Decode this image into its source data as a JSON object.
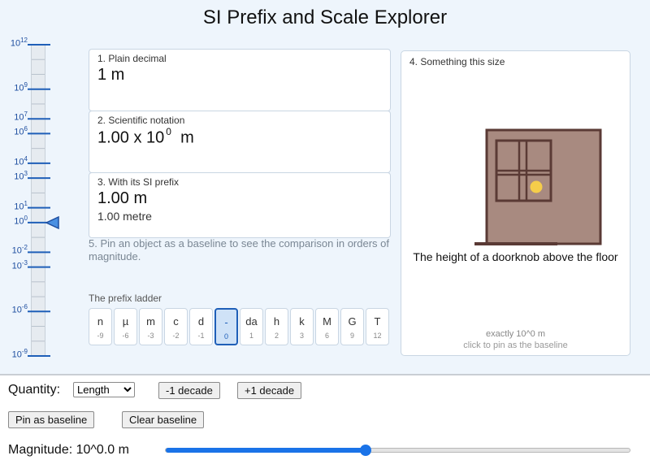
{
  "title": "SI Prefix and Scale Explorer",
  "ruler": {
    "labels": [
      {
        "base": "10",
        "exp": "12"
      },
      {
        "base": "10",
        "exp": "9"
      },
      {
        "base": "10",
        "exp": "7"
      },
      {
        "base": "10",
        "exp": "6"
      },
      {
        "base": "10",
        "exp": "4"
      },
      {
        "base": "10",
        "exp": "3"
      },
      {
        "base": "10",
        "exp": "1"
      },
      {
        "base": "10",
        "exp": "0"
      },
      {
        "base": "10",
        "exp": "-2"
      },
      {
        "base": "10",
        "exp": "-3"
      },
      {
        "base": "10",
        "exp": "-6"
      },
      {
        "base": "10",
        "exp": "-9"
      }
    ],
    "current_exponent": 0
  },
  "cards": {
    "plain": {
      "label": "1. Plain decimal",
      "value": "1 m"
    },
    "sci": {
      "label": "2. Scientific notation",
      "mantissa": "1.00 x 10",
      "exponent": "0",
      "unit": "m"
    },
    "prefix": {
      "label": "3. With its SI prefix",
      "value": "1.00 m",
      "spelled": "1.00 metre"
    }
  },
  "note": "5. Pin an object as a baseline to see the comparison in orders of magnitude.",
  "ladder": {
    "title": "The prefix ladder",
    "steps": [
      {
        "sym": "n",
        "exp": "-9"
      },
      {
        "sym": "µ",
        "exp": "-6"
      },
      {
        "sym": "m",
        "exp": "-3"
      },
      {
        "sym": "c",
        "exp": "-2"
      },
      {
        "sym": "d",
        "exp": "-1"
      },
      {
        "sym": "-",
        "exp": "0"
      },
      {
        "sym": "da",
        "exp": "1"
      },
      {
        "sym": "h",
        "exp": "2"
      },
      {
        "sym": "k",
        "exp": "3"
      },
      {
        "sym": "M",
        "exp": "6"
      },
      {
        "sym": "G",
        "exp": "9"
      },
      {
        "sym": "T",
        "exp": "12"
      }
    ],
    "active_index": 5
  },
  "object": {
    "label": "4. Something this size",
    "icon": "door-icon",
    "caption": "The height of a doorknob above the floor",
    "exact": "exactly 10^0 m",
    "hint": "click to pin as the baseline",
    "colors": {
      "door": "#a88a80",
      "frame": "#5a3a35",
      "knob": "#f5cd4a"
    }
  },
  "controls": {
    "quantity_label": "Quantity:",
    "quantity_value": "Length",
    "minus_decade": "-1 decade",
    "plus_decade": "+1 decade",
    "pin_baseline": "Pin as baseline",
    "clear_baseline": "Clear baseline",
    "magnitude_label": "Magnitude: 10^0.0 m",
    "slider_fraction": 0.43
  },
  "colors": {
    "accent": "#1a73e8",
    "ruler_blue": "#1f4fa0"
  }
}
